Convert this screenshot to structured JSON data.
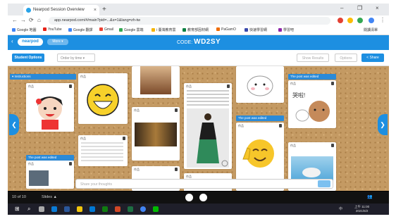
{
  "browser": {
    "tab_title": "Nearpod Session Overview",
    "tab_close": "×",
    "new_tab": "+",
    "window_controls": [
      "–",
      "❐",
      "×"
    ],
    "nav": [
      "←",
      "→",
      "⟳",
      "⌂"
    ],
    "url": "app.nearpod.com/#/main?pid=...&s=1&lang=zh-tw",
    "ext_colors": [
      "#e34133",
      "#fbbc05",
      "#34a853",
      "#4285f4"
    ]
  },
  "bookmarks": [
    {
      "label": "Google 地圖",
      "color": "#4285f4"
    },
    {
      "label": "YouTube",
      "color": "#e62117"
    },
    {
      "label": "Google 翻譯",
      "color": "#4285f4"
    },
    {
      "label": "Gmail",
      "color": "#ea4335"
    },
    {
      "label": "Google 雲端",
      "color": "#34a853"
    },
    {
      "label": "i 臺灣教育雲",
      "color": "#f4b400"
    },
    {
      "label": "教育部因材網",
      "color": "#0b8043"
    },
    {
      "label": "PaGamO",
      "color": "#ef6c00"
    },
    {
      "label": "快速學習網",
      "color": "#3949ab"
    },
    {
      "label": "學習吧",
      "color": "#8e24aa"
    }
  ],
  "reading_list": "閱讀清單",
  "nearpod": {
    "back": "‹",
    "logo": "nearpod",
    "more": "More ▾",
    "code_label": "CODE:",
    "code": "WD2SY",
    "student_options": "Student Options",
    "sort_dropdown": "Order by time ▾",
    "ghost_btn1": "Show Results",
    "ghost_btn2": "Options",
    "share": "< Share"
  },
  "board": {
    "col_heads": [
      "▾ Instructions",
      "The post was edited",
      "The post was edited",
      "The post was edited"
    ],
    "cards": [
      {
        "title": "作品"
      },
      {
        "title": "作品"
      },
      {
        "title": "作品"
      },
      {
        "title": "作品"
      },
      {
        "title": "作品"
      },
      {
        "title": "作品"
      },
      {
        "title": "作品"
      },
      {
        "title": "作品"
      },
      {
        "title": "作品"
      },
      {
        "title": "作品"
      },
      {
        "title": "作品"
      },
      {
        "title": "作品"
      }
    ],
    "speech": "哭啦!",
    "left_arrow": "❮",
    "right_arrow": "❯",
    "compose_placeholder": "Share your thoughts"
  },
  "slideshow": {
    "counter": "10 of 10",
    "label": "Slides ▲"
  },
  "taskbar": {
    "time": "上午 11:00",
    "date": "2021/6/2",
    "lang": "中"
  }
}
